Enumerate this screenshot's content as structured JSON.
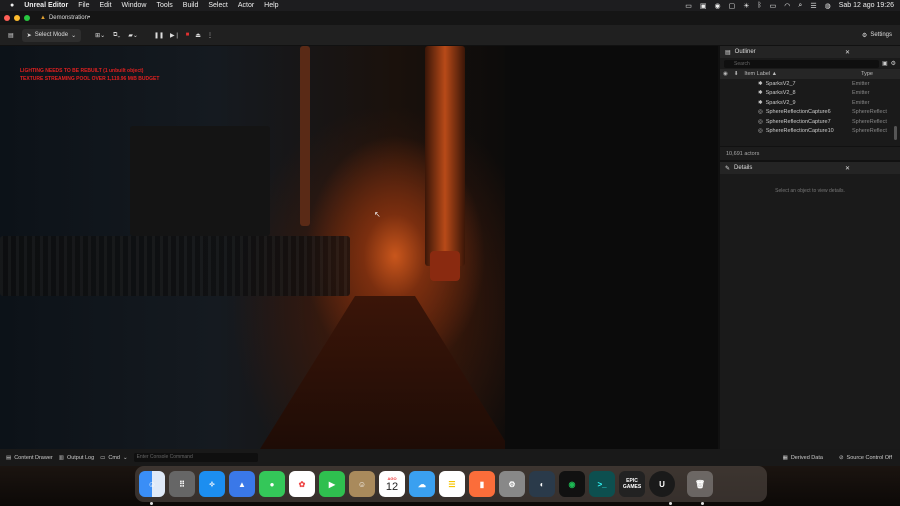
{
  "menubar": {
    "app_name": "Unreal Editor",
    "items": [
      "File",
      "Edit",
      "Window",
      "Tools",
      "Build",
      "Select",
      "Actor",
      "Help"
    ],
    "date_time": "Sab 12 ago  19:26"
  },
  "window": {
    "tab_title": "Demonstration•"
  },
  "toolbar": {
    "select_mode_label": "Select Mode",
    "settings_label": "Settings"
  },
  "viewport": {
    "warning_lines": [
      "LIGHTING NEEDS TO BE REBUILT (1 unbuilt object)",
      "TEXTURE STREAMING POOL OVER 1,119.96 MiB BUDGET"
    ]
  },
  "outliner": {
    "title": "Outliner",
    "search_placeholder": "Search",
    "col_label": "Item Label ▲",
    "col_type": "Type",
    "rows": [
      {
        "name": "SparksV2_7",
        "type": "Emitter"
      },
      {
        "name": "SparksV2_8",
        "type": "Emitter"
      },
      {
        "name": "SparksV2_9",
        "type": "Emitter"
      },
      {
        "name": "SphereReflectionCapture6",
        "type": "SphereReflect"
      },
      {
        "name": "SphereReflectionCapture7",
        "type": "SphereReflect"
      },
      {
        "name": "SphereReflectionCapture10",
        "type": "SphereReflect"
      }
    ],
    "actor_count": "10,691 actors"
  },
  "details": {
    "title": "Details",
    "empty_message": "Select an object to view details."
  },
  "statusbar": {
    "content_drawer": "Content Drawer",
    "output_log": "Output Log",
    "cmd": "Cmd",
    "console_placeholder": "Enter Console Command",
    "derived_data": "Derived Data",
    "source_control": "Source Control Off"
  },
  "dock": {
    "calendar_month": "AGO",
    "calendar_day": "12",
    "epic_label": "EPIC\nGAMES"
  },
  "colors": {
    "accent_orange": "#c9561c",
    "warning_red": "#e02020"
  }
}
